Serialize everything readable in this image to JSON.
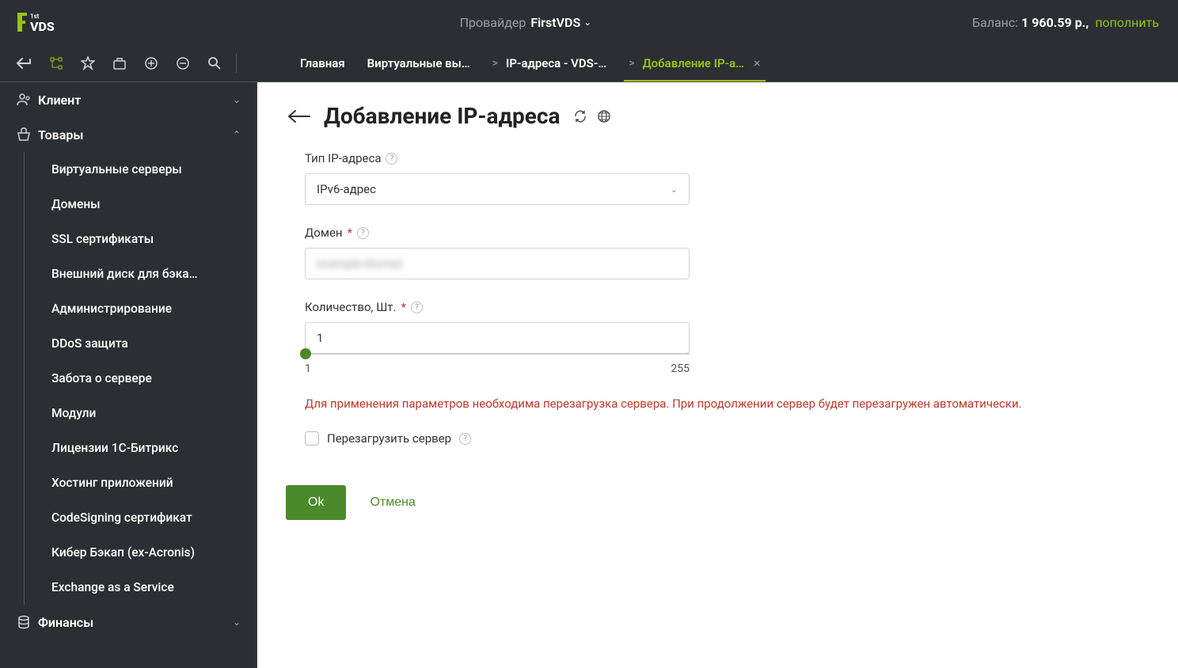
{
  "header": {
    "provider_label": "Провайдер",
    "provider_name": "FirstVDS",
    "balance_label": "Баланс:",
    "balance_value": "1 960.59 р.,",
    "topup": "пополнить"
  },
  "tabs": [
    {
      "label": "Главная",
      "active": false,
      "closable": false,
      "bc": false
    },
    {
      "label": "Виртуальные вы…",
      "active": false,
      "closable": false,
      "bc": false
    },
    {
      "label": "IP-адреса - VDS-…",
      "active": false,
      "closable": false,
      "bc": true
    },
    {
      "label": "Добавление IP-а…",
      "active": true,
      "closable": true,
      "bc": true
    }
  ],
  "sidebar": {
    "client": {
      "label": "Клиент"
    },
    "products": {
      "label": "Товары",
      "expanded": true,
      "items": [
        "Виртуальные серверы",
        "Домены",
        "SSL сертификаты",
        "Внешний диск для бэка…",
        "Администрирование",
        "DDoS защита",
        "Забота о сервере",
        "Модули",
        "Лицензии 1С-Битрикс",
        "Хостинг приложений",
        "CodeSigning сертификат",
        "Кибер Бэкап (ex-Acronis)",
        "Exchange as a Service"
      ]
    },
    "finance": {
      "label": "Финансы"
    }
  },
  "page": {
    "title": "Добавление IP-адреса",
    "ip_type_label": "Тип IP-адреса",
    "ip_type_value": "IPv6-адрес",
    "domain_label": "Домен",
    "domain_value": "example-blurred",
    "qty_label": "Количество, Шт.",
    "qty_value": "1",
    "qty_min": "1",
    "qty_max": "255",
    "warning": "Для применения параметров необходима перезагрузка сервера. При продолжении сервер будет перезагружен автоматически.",
    "reboot_label": "Перезагрузить сервер",
    "ok": "Ok",
    "cancel": "Отмена"
  }
}
